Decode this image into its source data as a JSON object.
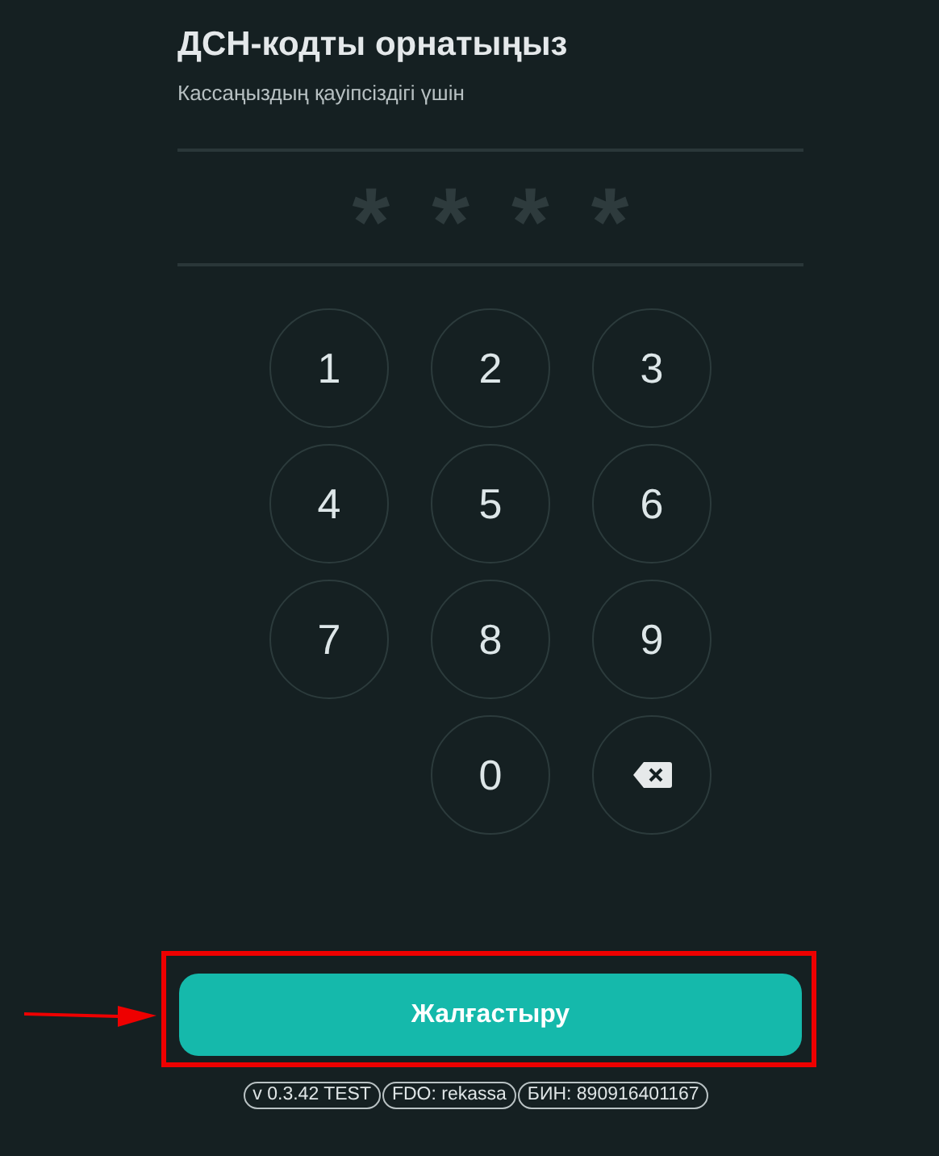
{
  "header": {
    "title": "ДСН-кодты орнатыңыз",
    "subtitle": "Кассаңыздың қауіпсіздігі үшін"
  },
  "pin": {
    "mask": [
      "*",
      "*",
      "*",
      "*"
    ]
  },
  "keypad": [
    {
      "kind": "digit",
      "label": "1"
    },
    {
      "kind": "digit",
      "label": "2"
    },
    {
      "kind": "digit",
      "label": "3"
    },
    {
      "kind": "digit",
      "label": "4"
    },
    {
      "kind": "digit",
      "label": "5"
    },
    {
      "kind": "digit",
      "label": "6"
    },
    {
      "kind": "digit",
      "label": "7"
    },
    {
      "kind": "digit",
      "label": "8"
    },
    {
      "kind": "digit",
      "label": "9"
    },
    {
      "kind": "empty"
    },
    {
      "kind": "digit",
      "label": "0"
    },
    {
      "kind": "backspace"
    }
  ],
  "continue_button": {
    "label": "Жалғастыру"
  },
  "footer_badges": [
    "v 0.3.42 TEST",
    "FDO: rekassa",
    "БИН: 890916401167"
  ]
}
